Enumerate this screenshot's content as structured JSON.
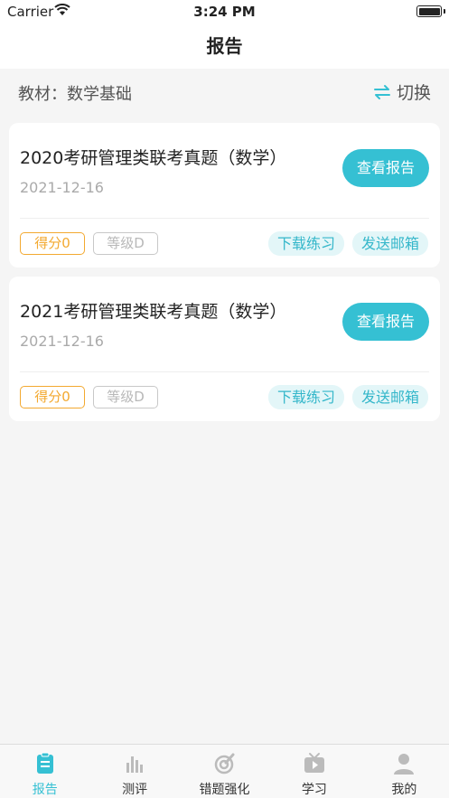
{
  "status_bar": {
    "carrier": "Carrier",
    "time": "3:24 PM"
  },
  "nav": {
    "title": "报告"
  },
  "material": {
    "label": "教材：数学基础",
    "switch_label": "切换"
  },
  "reports": [
    {
      "title": "2020考研管理类联考真题（数学）",
      "date": "2021-12-16",
      "view_label": "查看报告",
      "score": "得分0",
      "grade": "等级D",
      "download_label": "下载练习",
      "email_label": "发送邮箱"
    },
    {
      "title": "2021考研管理类联考真题（数学）",
      "date": "2021-12-16",
      "view_label": "查看报告",
      "score": "得分0",
      "grade": "等级D",
      "download_label": "下载练习",
      "email_label": "发送邮箱"
    }
  ],
  "tabs": [
    {
      "label": "报告",
      "icon": "report-icon",
      "active": true
    },
    {
      "label": "测评",
      "icon": "bar-chart-icon",
      "active": false
    },
    {
      "label": "错题强化",
      "icon": "target-pen-icon",
      "active": false
    },
    {
      "label": "学习",
      "icon": "tv-play-icon",
      "active": false
    },
    {
      "label": "我的",
      "icon": "user-icon",
      "active": false
    }
  ],
  "colors": {
    "accent": "#35c0d3",
    "score": "#f3a930",
    "background": "#f5f5f5"
  }
}
